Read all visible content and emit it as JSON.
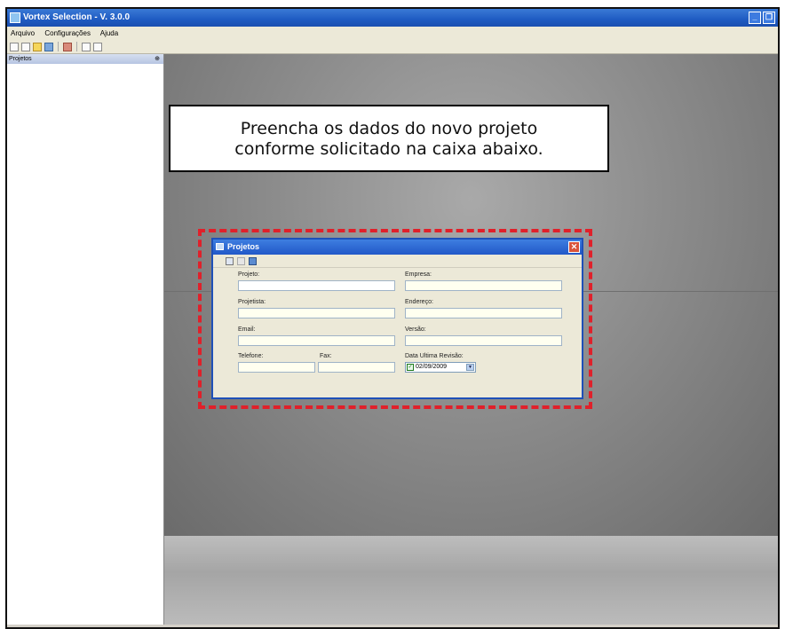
{
  "window": {
    "title": "Vortex Selection - V. 3.0.0",
    "controls": [
      "minimize-icon",
      "restore-icon"
    ]
  },
  "menu": {
    "items": [
      "Arquivo",
      "Configurações",
      "Ajuda"
    ]
  },
  "toolbar": {
    "icons": [
      "new-icon",
      "list-icon",
      "open-icon",
      "save-icon",
      "print-icon",
      "export-icon",
      "delete-icon"
    ]
  },
  "sidebar": {
    "title": "Projetos",
    "pin": "⊕"
  },
  "callout": {
    "line1": "Preencha os dados do novo projeto",
    "line2": "conforme solicitado na caixa abaixo."
  },
  "highlight_color": "#e0202a",
  "dialog": {
    "title": "Projetos",
    "close": "✕",
    "labels": {
      "projeto": "Projeto:",
      "empresa": "Empresa:",
      "projetista": "Projetista:",
      "endereco": "Endereço:",
      "email": "Email:",
      "versao": "Versão:",
      "telefone": "Telefone:",
      "fax": "Fax:",
      "data_revisao": "Data Ultima Revisão:"
    },
    "values": {
      "data_revisao": "02/09/2009"
    }
  }
}
